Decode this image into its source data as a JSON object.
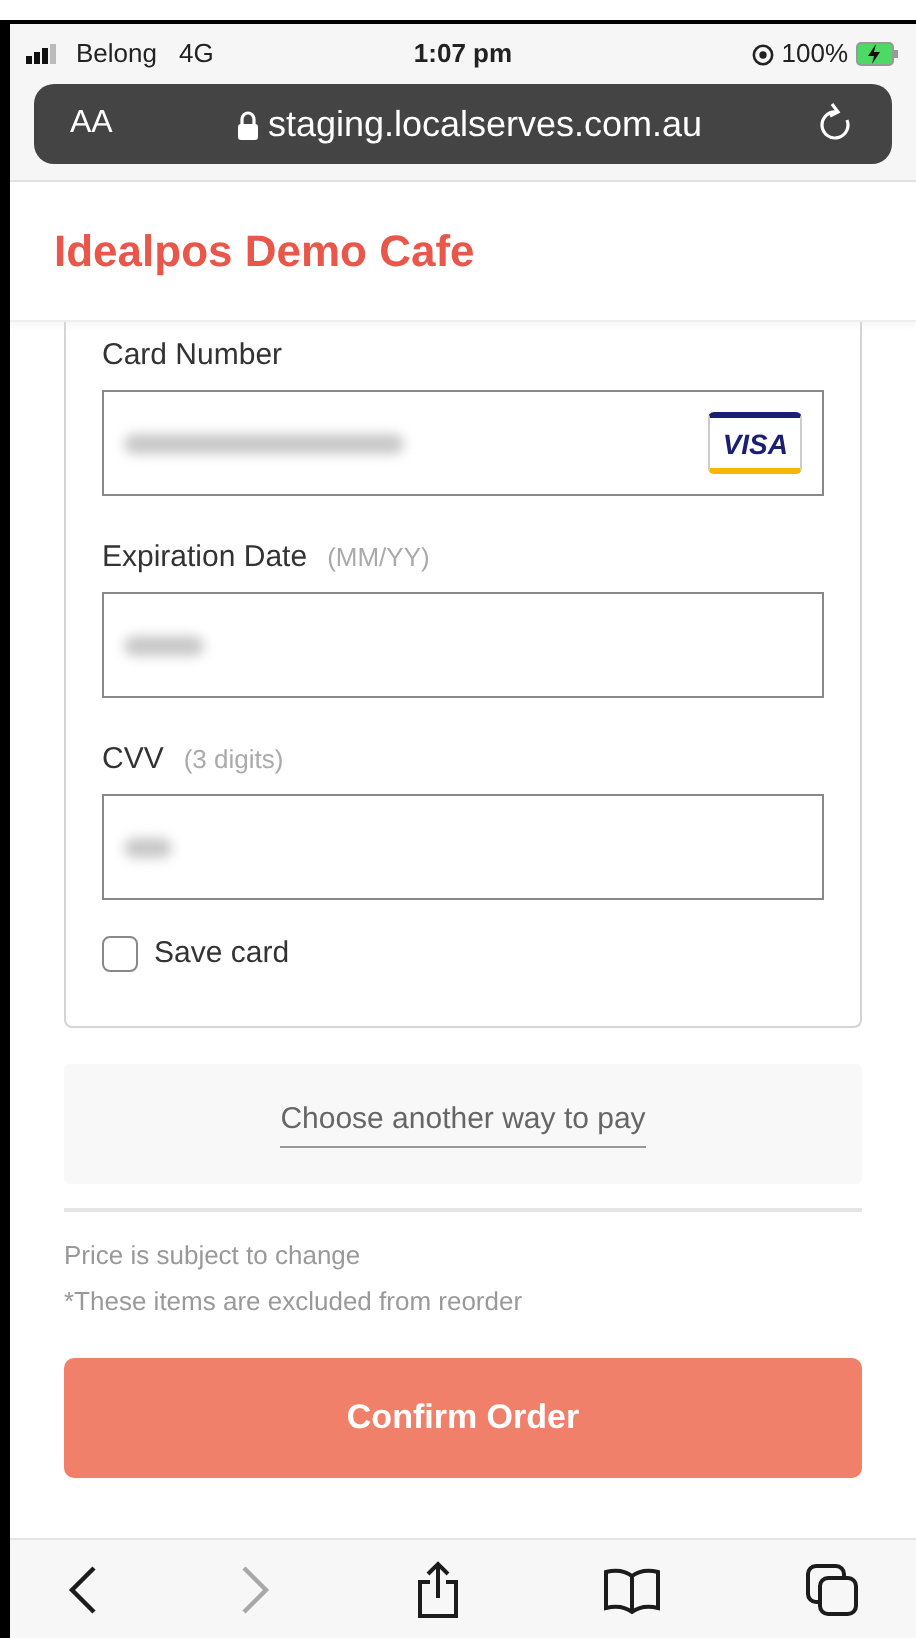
{
  "status_bar": {
    "carrier": "Belong",
    "network": "4G",
    "time": "1:07 pm",
    "battery": "100%",
    "charging": true
  },
  "address_bar": {
    "text_size": "AA",
    "url": "staging.localserves.com.au",
    "secure": true
  },
  "header": {
    "title": "Idealpos Demo Cafe"
  },
  "card_form": {
    "fields": [
      {
        "label": "Card Number",
        "obscured": true,
        "brand": "VISA"
      },
      {
        "label": "Expiration Date",
        "hint": "(MM/YY)",
        "obscured": true
      },
      {
        "label": "CVV",
        "hint": "(3 digits)",
        "obscured": true
      }
    ],
    "save_card": {
      "label": "Save card",
      "checked": false
    }
  },
  "alt_payment": {
    "link": "Choose another way to pay"
  },
  "notes": [
    "Price is subject to change",
    "*These items are excluded from reorder"
  ],
  "confirm_button": {
    "label": "Confirm Order",
    "disabled": false
  },
  "toolbar": [
    {
      "kind": "back",
      "disabled": false
    },
    {
      "kind": "forward",
      "disabled": true
    },
    {
      "kind": "share",
      "disabled": false
    },
    {
      "kind": "bookmarks",
      "disabled": false
    },
    {
      "kind": "tabs",
      "disabled": false
    }
  ]
}
